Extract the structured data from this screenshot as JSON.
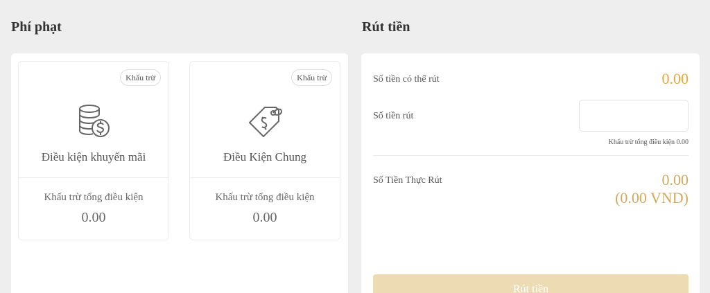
{
  "penalty": {
    "title": "Phí phạt",
    "cards": [
      {
        "badge": "Khấu trừ",
        "icon": "coins-dollar-icon",
        "name": "Điều kiện khuyến mãi",
        "sub_label": "Khấu trừ tổng điều kiện",
        "value": "0.00"
      },
      {
        "badge": "Khấu trừ",
        "icon": "price-tag-dollar-icon",
        "name": "Điều Kiện Chung",
        "sub_label": "Khấu trừ tổng điều kiện",
        "value": "0.00"
      }
    ]
  },
  "withdraw": {
    "title": "Rút tiền",
    "available_label": "Số tiền có thể rút",
    "available_value": "0.00",
    "amount_label": "Số tiền rút",
    "amount_value": "",
    "deduct_hint": "Khấu trừ tổng điều kiện 0.00",
    "actual_label": "Số Tiền Thực Rút",
    "actual_value": "0.00",
    "actual_value_vnd": "(0.00 VND)",
    "button_label": "Rút tiền"
  },
  "colors": {
    "accent_gold": "#e6a838",
    "button_disabled": "#eddcb3",
    "background": "#eeeeee"
  }
}
